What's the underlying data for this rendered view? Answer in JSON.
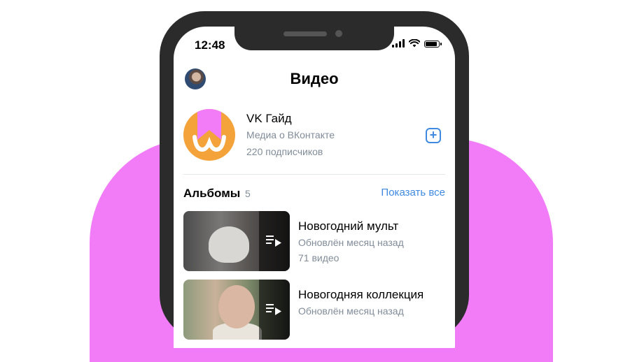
{
  "status_bar": {
    "time": "12:48"
  },
  "header": {
    "title": "Видео"
  },
  "group": {
    "name": "VK Гайд",
    "description": "Медиа о ВКонтакте",
    "subscribers": "220 подписчиков",
    "add_symbol": "+"
  },
  "albums_section": {
    "title": "Альбомы",
    "count": "5",
    "show_all": "Показать все"
  },
  "albums": [
    {
      "name": "Новогодний мульт",
      "updated": "Обновлён месяц назад",
      "videos": "71 видео"
    },
    {
      "name": "Новогодняя коллекция",
      "updated": "Обновлён месяц назад"
    }
  ],
  "colors": {
    "background_blob": "#f27cf7",
    "phone_frame": "#2b2b2b",
    "accent": "#3f8ae0",
    "secondary_text": "#818c99",
    "group_logo": "#f4a23a",
    "logo_mark": "#f27cf7"
  }
}
